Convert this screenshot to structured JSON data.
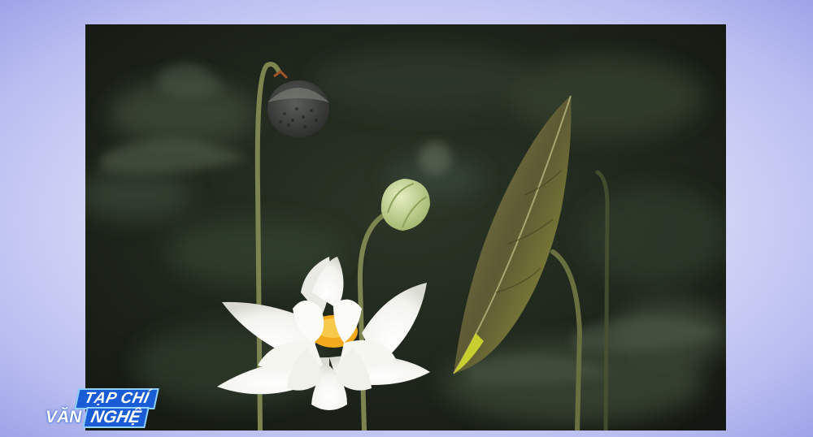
{
  "scene": {
    "subject": "white-lotus-flower",
    "colors": {
      "background_glow": "#d9dcf7",
      "background_edge": "#9ea3e8",
      "photo_dark": "#1c2119",
      "petal": "#f7f7f4",
      "stamen": "#f2a91c",
      "bud": "#c9d8a0",
      "leaf": "#6f6a3c",
      "stem": "#7c8450"
    }
  },
  "logo": {
    "line1": "TẠP CHÍ",
    "line2_a": "VĂN",
    "line2_b": "NGHỆ",
    "accent_color": "#1a5bd6"
  }
}
